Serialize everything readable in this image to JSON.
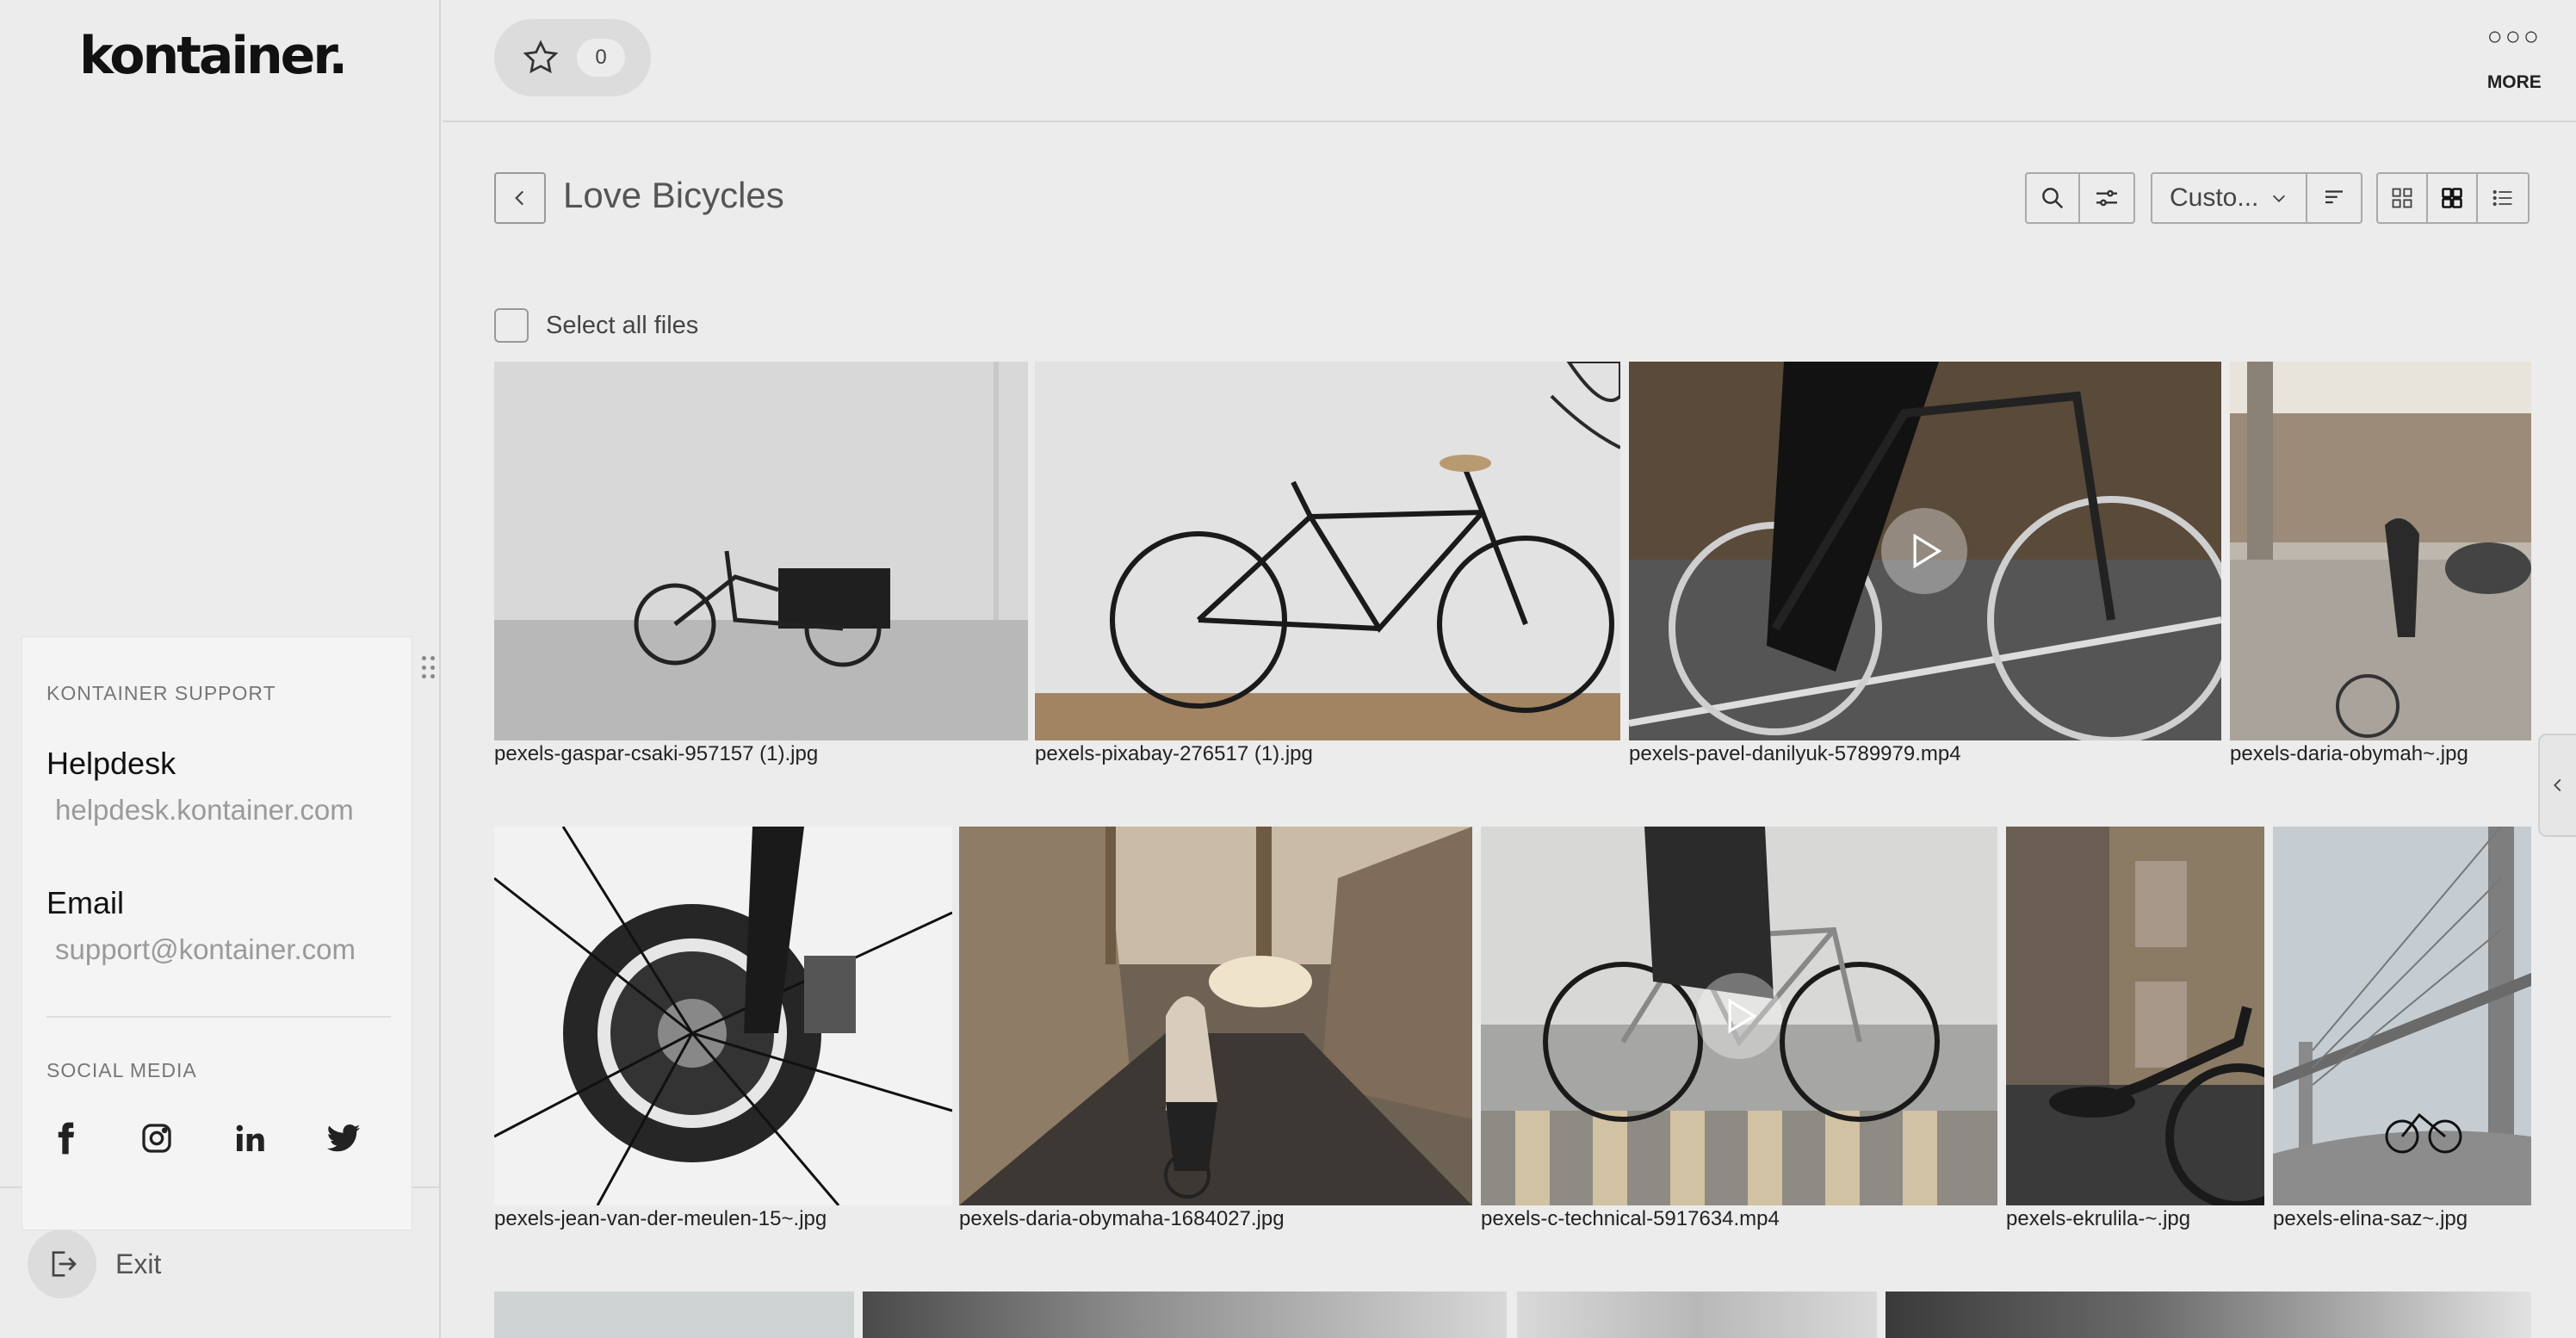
{
  "app": {
    "logo_text": "kontainer.",
    "exit_label": "Exit"
  },
  "support": {
    "heading": "KONTAINER SUPPORT",
    "helpdesk_title": "Helpdesk",
    "helpdesk_link": "helpdesk.kontainer.com",
    "email_title": "Email",
    "email_link": "support@kontainer.com",
    "social_heading": "SOCIAL MEDIA",
    "socials": [
      "facebook-icon",
      "instagram-icon",
      "linkedin-icon",
      "twitter-icon"
    ]
  },
  "topbar": {
    "favorites_count": "0",
    "more_label": "MORE"
  },
  "folder": {
    "title": "Love Bicycles",
    "sort_value": "Custo...",
    "select_all_label": "Select all files"
  },
  "files": [
    {
      "name": "pexels-gaspar-csaki-957157 (1).jpg",
      "type": "image"
    },
    {
      "name": "pexels-pixabay-276517 (1).jpg",
      "type": "image"
    },
    {
      "name": "pexels-pavel-danilyuk-5789979.mp4",
      "type": "video"
    },
    {
      "name": "pexels-daria-obymah~.jpg",
      "type": "image"
    },
    {
      "name": "pexels-jean-van-der-meulen-15~.jpg",
      "type": "image"
    },
    {
      "name": "pexels-daria-obymaha-1684027.jpg",
      "type": "image"
    },
    {
      "name": "pexels-c-technical-5917634.mp4",
      "type": "video"
    },
    {
      "name": "pexels-ekrulila-~.jpg",
      "type": "image"
    },
    {
      "name": "pexels-elina-saz~.jpg",
      "type": "image"
    }
  ],
  "colors": {
    "background": "#ececec",
    "panel": "#f4f4f4",
    "text": "#222222",
    "muted": "#9a9a9a"
  }
}
